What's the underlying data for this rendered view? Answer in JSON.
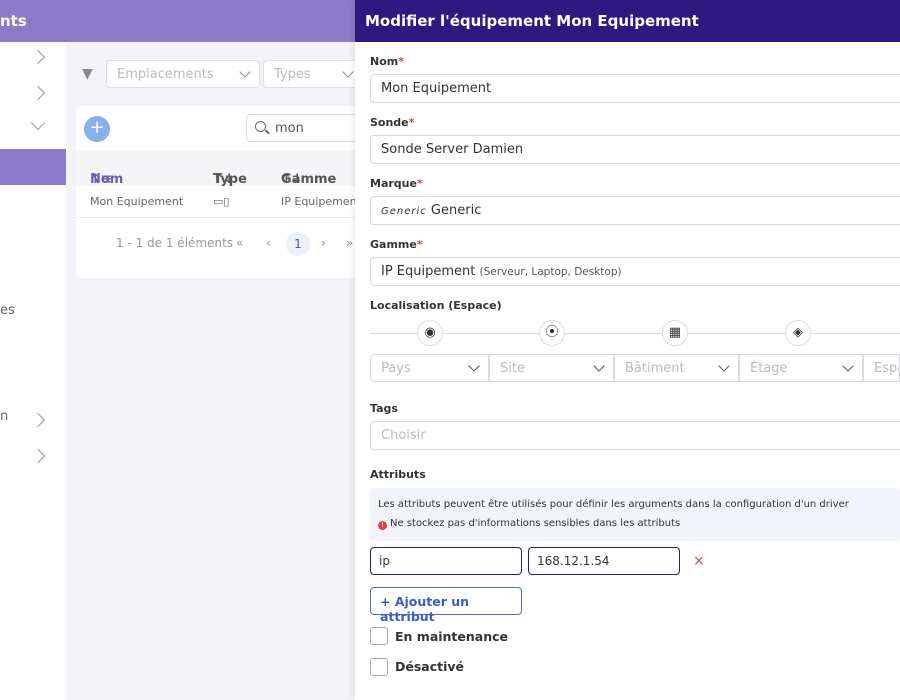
{
  "background_app": {
    "topbar_title_fragment": "nts",
    "sidebar_text_fragments": [
      "es",
      "n"
    ],
    "filters": {
      "locations_placeholder": "Emplacements",
      "types_placeholder": "Types"
    },
    "search_value": "mon",
    "table": {
      "columns": [
        "Nom",
        "Type",
        "Gamme"
      ],
      "rows": [
        {
          "name": "Mon Equipement",
          "type_icon": "server-icon",
          "range": "IP Equipemen"
        }
      ]
    },
    "pagination": {
      "summary": "1 - 1 de 1 éléments",
      "first": "«",
      "prev": "‹",
      "current": "1",
      "next": "›",
      "last": "»"
    }
  },
  "panel": {
    "title": "Modifier l'équipement Mon Equipement",
    "fields": {
      "name": {
        "label": "Nom",
        "required": "*",
        "value": "Mon Equipement"
      },
      "probe": {
        "label": "Sonde",
        "required": "*",
        "value": "Sonde Server Damien"
      },
      "brand": {
        "label": "Marque",
        "required": "*",
        "logo_text": "Generic",
        "value": "Generic"
      },
      "range": {
        "label": "Gamme",
        "required": "*",
        "value": "IP Equipement",
        "hint": "(Serveur, Laptop, Desktop)"
      }
    },
    "location": {
      "label": "Localisation (Espace)",
      "icons": [
        "globe-icon",
        "map-pin-icon",
        "building-icon",
        "layers-icon"
      ],
      "selects": [
        "Pays",
        "Site",
        "Bâtiment",
        "Étage",
        "Espa"
      ]
    },
    "tags": {
      "label": "Tags",
      "placeholder": "Choisir"
    },
    "attributes": {
      "label": "Attributs",
      "info_line1": "Les attributs peuvent être utilisés pour définir les arguments dans la configuration d'un driver",
      "info_line2": "Ne stockez pas d'informations sensibles dans les attributs",
      "items": [
        {
          "key": "ip",
          "value": "168.12.1.54"
        }
      ],
      "delete_symbol": "×",
      "add_label": "Ajouter un attribut"
    },
    "checkboxes": {
      "maintenance": {
        "label": "En maintenance",
        "checked": false
      },
      "disabled": {
        "label": "Désactivé",
        "checked": false
      }
    }
  },
  "colors": {
    "panel_header": "#2d1980",
    "accent_purple": "#8b7ac6",
    "required": "#e04040",
    "link_blue": "#3d5bc9"
  }
}
